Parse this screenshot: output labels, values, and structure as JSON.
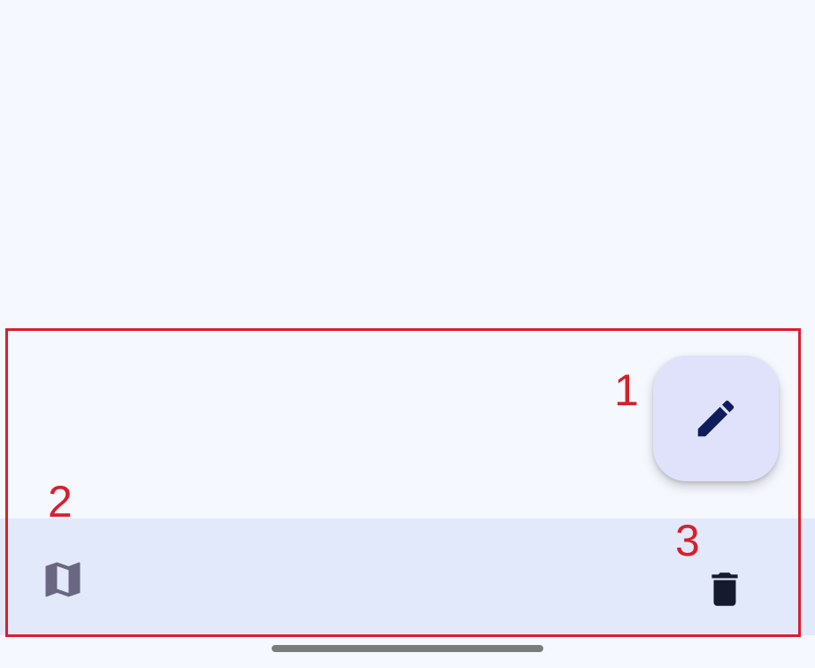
{
  "app": {
    "background_color": "#f5f8fe",
    "bottom_bar_color": "#e1e9fb"
  },
  "fab": {
    "icon": "pencil-icon",
    "icon_color": "#0f1d5c",
    "background_color": "#e0e2fb"
  },
  "bottom_bar": {
    "left_action": {
      "icon": "map-icon",
      "icon_color": "#6a6783"
    },
    "right_action": {
      "icon": "trash-icon",
      "icon_color": "#161a2e"
    }
  },
  "annotations": {
    "box_color": "#d81f2c",
    "markers": [
      "1",
      "2",
      "3"
    ]
  }
}
